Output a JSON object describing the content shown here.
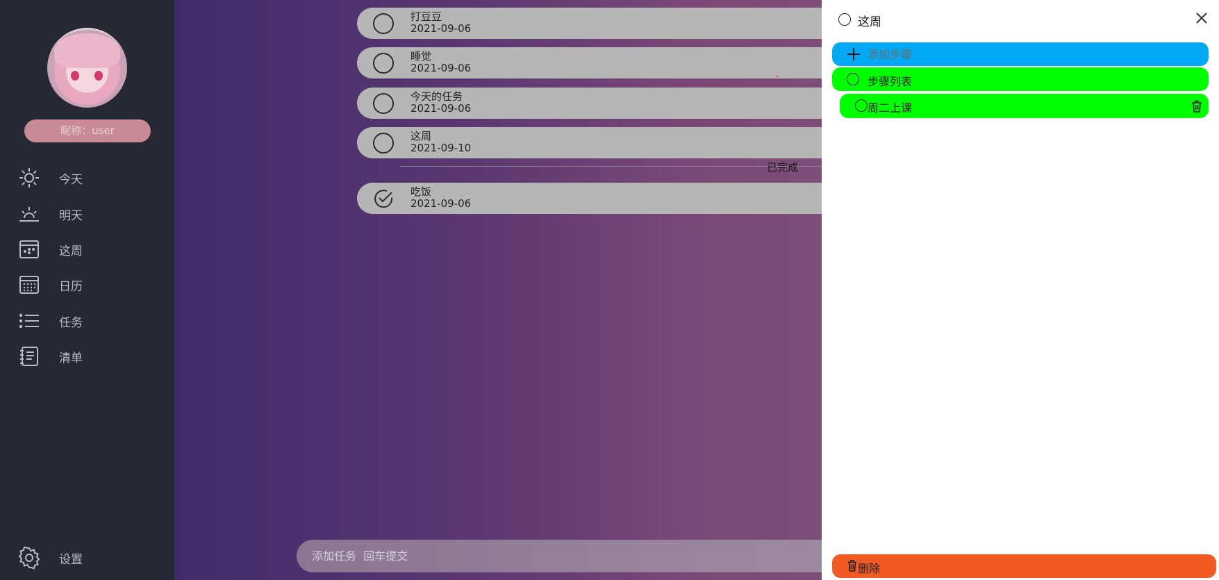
{
  "sidebar": {
    "nickname": "昵称：user",
    "items": [
      {
        "label": "今天",
        "icon": "sun-icon"
      },
      {
        "label": "明天",
        "icon": "sunrise-icon"
      },
      {
        "label": "这周",
        "icon": "week-calendar-icon"
      },
      {
        "label": "日历",
        "icon": "calendar-grid-icon"
      },
      {
        "label": "任务",
        "icon": "list-icon"
      },
      {
        "label": "清单",
        "icon": "notebook-icon"
      }
    ],
    "settings": {
      "label": "设置",
      "icon": "gear-icon"
    }
  },
  "tasks": [
    {
      "name": "打豆豆",
      "date": "2021-09-06",
      "done": false
    },
    {
      "name": "睡觉",
      "date": "2021-09-06",
      "done": false
    },
    {
      "name": "今天的任务",
      "date": "2021-09-06",
      "done": false
    },
    {
      "name": "这周",
      "date": "2021-09-10",
      "done": false
    }
  ],
  "completed_label": "已完成",
  "completed_tasks": [
    {
      "name": "吃饭",
      "date": "2021-09-06",
      "done": true
    }
  ],
  "add_task": {
    "placeholder": "添加任务  回车提交"
  },
  "detail": {
    "title": "这周",
    "add_step_placeholder": "添加步骤",
    "step_list_label": "步骤列表",
    "steps": [
      {
        "label": "周二上课"
      }
    ],
    "delete_label": "删除"
  },
  "colors": {
    "sidebar_bg": "#262833",
    "add_step_bg": "#03a9f4",
    "step_bg": "#00ff00",
    "delete_bg": "#f15a22",
    "task_bg": "#b6b6b6"
  }
}
